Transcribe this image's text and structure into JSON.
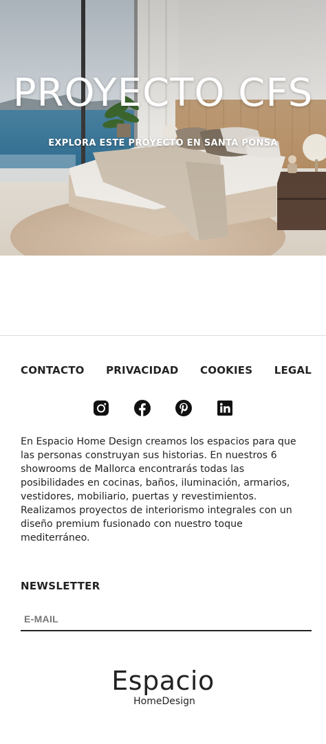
{
  "hero": {
    "title": "PROYECTO CFS",
    "subtitle": "EXPLORA ESTE PROYECTO EN SANTA PONSA"
  },
  "footer_nav": {
    "items": [
      {
        "label": "CONTACTO"
      },
      {
        "label": "PRIVACIDAD"
      },
      {
        "label": "COOKIES"
      },
      {
        "label": "LEGAL"
      }
    ]
  },
  "social": {
    "icons": [
      "instagram-icon",
      "facebook-icon",
      "pinterest-icon",
      "linkedin-icon"
    ]
  },
  "about": {
    "text": "En Espacio Home Design creamos los espacios para que las personas construyan sus historias. En nuestros 6 showrooms de Mallorca encontrarás todas las posibilidades en cocinas, baños, iluminación, armarios, vestidores, mobiliario, puertas y revestimientos. Realizamos proyectos de interiorismo integrales con un diseño premium fusionado con nuestro toque mediterráneo."
  },
  "newsletter": {
    "title": "NEWSLETTER",
    "placeholder": "E-MAIL",
    "value": ""
  },
  "logo": {
    "main": "Espacio",
    "sub": "HomeDesign"
  },
  "colors": {
    "text": "#222222",
    "divider": "#dcdcdc",
    "placeholder": "#777777"
  }
}
